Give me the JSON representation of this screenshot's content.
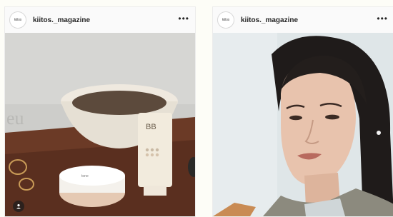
{
  "posts": [
    {
      "username": "kiitos._magazine",
      "avatar_text": "kiitos",
      "more_icon": "ellipsis-icon",
      "product_labels": {
        "bb_title": "BB"
      }
    },
    {
      "username": "kiitos._magazine",
      "avatar_text": "kiitos",
      "more_icon": "ellipsis-icon"
    }
  ],
  "colors": {
    "card_bg": "#fafafa",
    "page_bg": "#fdfdf7",
    "text": "#262626"
  }
}
